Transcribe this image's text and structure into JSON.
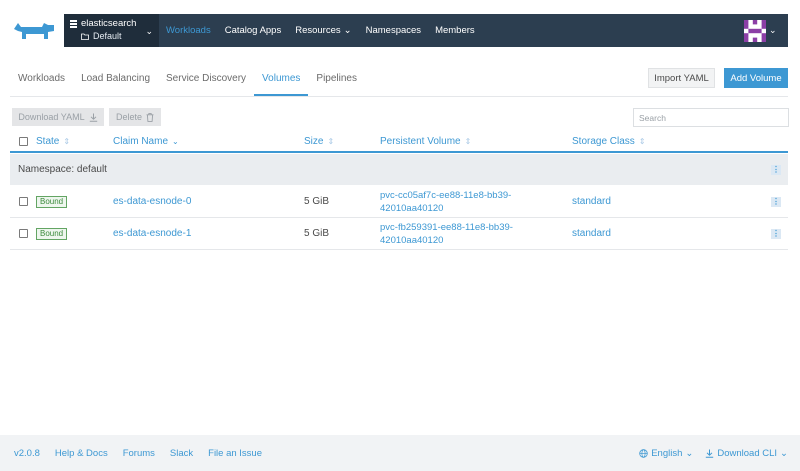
{
  "cluster": {
    "name": "elasticsearch",
    "project": "Default"
  },
  "nav": [
    {
      "label": "Workloads",
      "active": true,
      "dropdown": false
    },
    {
      "label": "Catalog Apps",
      "active": false,
      "dropdown": false
    },
    {
      "label": "Resources",
      "active": false,
      "dropdown": true
    },
    {
      "label": "Namespaces",
      "active": false,
      "dropdown": false
    },
    {
      "label": "Members",
      "active": false,
      "dropdown": false
    }
  ],
  "tabs": [
    {
      "label": "Workloads",
      "active": false
    },
    {
      "label": "Load Balancing",
      "active": false
    },
    {
      "label": "Service Discovery",
      "active": false
    },
    {
      "label": "Volumes",
      "active": true
    },
    {
      "label": "Pipelines",
      "active": false
    }
  ],
  "actions": {
    "import_label": "Import YAML",
    "add_label": "Add Volume"
  },
  "toolbar": {
    "download_label": "Download YAML",
    "delete_label": "Delete",
    "search_placeholder": "Search"
  },
  "table": {
    "headers": {
      "state": "State",
      "claim_name": "Claim Name",
      "size": "Size",
      "persistent_volume": "Persistent Volume",
      "storage_class": "Storage Class"
    },
    "group_label": "Namespace: default",
    "rows": [
      {
        "state": "Bound",
        "claim_name": "es-data-esnode-0",
        "size": "5 GiB",
        "pv_line1": "pvc-cc05af7c-ee88-11e8-bb39-",
        "pv_line2": "42010aa40120",
        "storage_class": "standard"
      },
      {
        "state": "Bound",
        "claim_name": "es-data-esnode-1",
        "size": "5 GiB",
        "pv_line1": "pvc-fb259391-ee88-11e8-bb39-",
        "pv_line2": "42010aa40120",
        "storage_class": "standard"
      }
    ]
  },
  "footer": {
    "version": "v2.0.8",
    "links": [
      "Help & Docs",
      "Forums",
      "Slack",
      "File an Issue"
    ],
    "language": "English",
    "download_cli": "Download CLI"
  },
  "colors": {
    "accent": "#3d98d3",
    "nav_bg": "#2c3e50",
    "state_ok": "#3c8a3c"
  }
}
